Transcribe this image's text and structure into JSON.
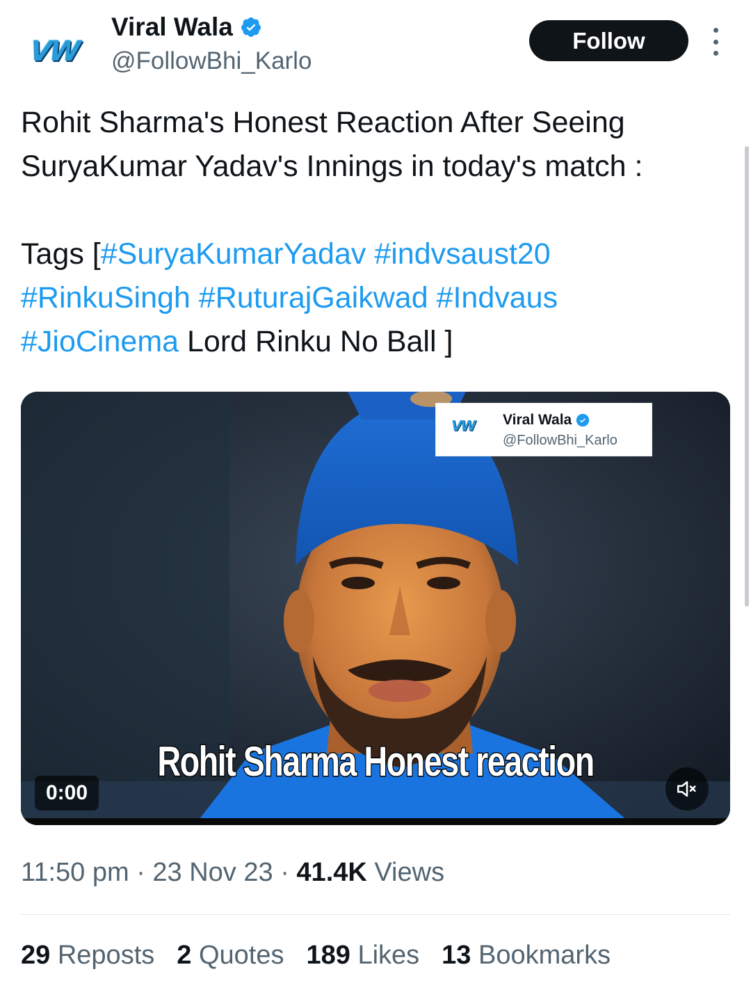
{
  "author": {
    "display_name": "Viral Wala",
    "handle": "@FollowBhi_Karlo",
    "avatar_text": "VW",
    "verified": true
  },
  "follow_label": "Follow",
  "tweet": {
    "line1": "Rohit Sharma's Honest Reaction After Seeing",
    "line2": "SuryaKumar Yadav's Innings in today's match :",
    "tags_prefix": "Tags [",
    "hashtags": [
      "#SuryaKumarYadav",
      "#indvsaust20",
      "#RinkuSingh",
      "#RuturajGaikwad",
      "#Indvaus",
      "#JioCinema"
    ],
    "tags_suffix": "Lord Rinku No Ball ]"
  },
  "media": {
    "overlay_name": "Viral Wala",
    "overlay_handle": "@FollowBhi_Karlo",
    "overlay_logo": "VW",
    "caption": "Rohit Sharma Honest reaction",
    "time": "0:00",
    "muted": true
  },
  "meta": {
    "time": "11:50 pm",
    "sep": "·",
    "date": "23 Nov 23",
    "views_count": "41.4K",
    "views_label": "Views"
  },
  "stats": {
    "reposts_count": "29",
    "reposts_label": "Reposts",
    "quotes_count": "2",
    "quotes_label": "Quotes",
    "likes_count": "189",
    "likes_label": "Likes",
    "bookmarks_count": "13",
    "bookmarks_label": "Bookmarks"
  },
  "colors": {
    "link": "#1d9bf0",
    "verified": "#1d9bf0",
    "text": "#0f1419",
    "muted_text": "#536471"
  }
}
